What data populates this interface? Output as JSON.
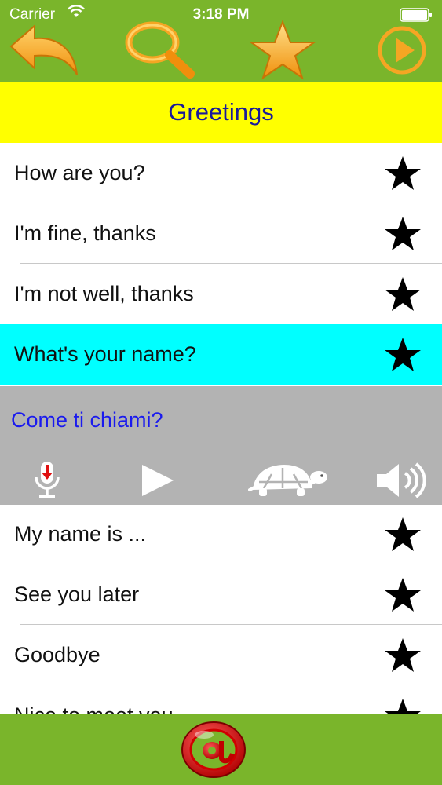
{
  "status_bar": {
    "carrier": "Carrier",
    "time": "3:18 PM"
  },
  "toolbar": {
    "back_icon": "back-arrow-icon",
    "search_icon": "magnifier-icon",
    "favorites_icon": "star-icon",
    "play_icon": "play-circle-icon"
  },
  "header": {
    "title": "Greetings"
  },
  "phrases": [
    {
      "text": "How are you?",
      "favorite_icon": "star-icon"
    },
    {
      "text": "I'm fine, thanks",
      "favorite_icon": "star-icon"
    },
    {
      "text": "I'm not well, thanks",
      "favorite_icon": "star-icon"
    },
    {
      "text": "What's your name?",
      "favorite_icon": "star-icon",
      "selected": true
    },
    {
      "text": "My name is ...",
      "favorite_icon": "star-icon"
    },
    {
      "text": "See you later",
      "favorite_icon": "star-icon"
    },
    {
      "text": "Goodbye",
      "favorite_icon": "star-icon"
    },
    {
      "text": "Nice to meet you",
      "favorite_icon": "star-icon"
    }
  ],
  "translation_panel": {
    "translation": "Come ti chiami?",
    "controls": [
      "microphone-icon",
      "play-icon",
      "turtle-slow-icon",
      "speaker-icon"
    ]
  },
  "bottom_bar": {
    "contact_icon": "at-sign-icon"
  },
  "colors": {
    "bar_green": "#7ab52b",
    "title_yellow": "#ffff00",
    "title_text": "#1a1a9a",
    "selected_row": "#00ffff",
    "panel_gray": "#b3b3b3",
    "translation_text": "#1a1aee",
    "icon_orange": "#f5a623"
  }
}
